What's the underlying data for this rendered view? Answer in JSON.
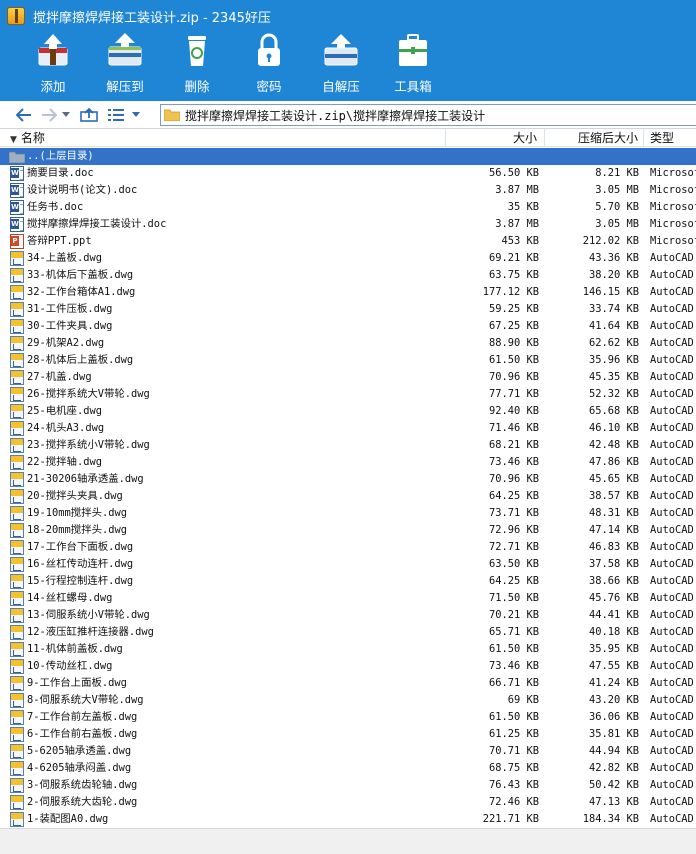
{
  "window": {
    "title": "搅拌摩擦焊焊接工装设计.zip - 2345好压"
  },
  "toolbar": {
    "items": [
      {
        "label": "添加",
        "icon": "add-archive-icon"
      },
      {
        "label": "解压到",
        "icon": "extract-to-icon"
      },
      {
        "label": "删除",
        "icon": "delete-trash-icon"
      },
      {
        "label": "密码",
        "icon": "password-lock-icon"
      },
      {
        "label": "自解压",
        "icon": "self-extract-icon"
      },
      {
        "label": "工具箱",
        "icon": "toolbox-icon"
      }
    ]
  },
  "address": {
    "path": "搅拌摩擦焊焊接工装设计.zip\\搅拌摩擦焊焊接工装设计"
  },
  "columns": {
    "name": "名称",
    "size": "大小",
    "csize": "压缩后大小",
    "type": "类型"
  },
  "files": [
    {
      "name": "..(上层目录)",
      "size": "",
      "csize": "",
      "type": "",
      "icon": "folder",
      "selected": true
    },
    {
      "name": "摘要目录.doc",
      "size": "56.50 KB",
      "csize": "8.21 KB",
      "type": "Microsoft",
      "icon": "doc"
    },
    {
      "name": "设计说明书(论文).doc",
      "size": "3.87 MB",
      "csize": "3.05 MB",
      "type": "Microsoft",
      "icon": "doc"
    },
    {
      "name": "任务书.doc",
      "size": "35 KB",
      "csize": "5.70 KB",
      "type": "Microsoft",
      "icon": "doc"
    },
    {
      "name": "搅拌摩擦焊焊接工装设计.doc",
      "size": "3.87 MB",
      "csize": "3.05 MB",
      "type": "Microsoft",
      "icon": "doc"
    },
    {
      "name": "答辩PPT.ppt",
      "size": "453 KB",
      "csize": "212.02 KB",
      "type": "Microsoft",
      "icon": "ppt"
    },
    {
      "name": "34-上盖板.dwg",
      "size": "69.21 KB",
      "csize": "43.36 KB",
      "type": "AutoCAD",
      "icon": "dwg"
    },
    {
      "name": "33-机体后下盖板.dwg",
      "size": "63.75 KB",
      "csize": "38.20 KB",
      "type": "AutoCAD",
      "icon": "dwg"
    },
    {
      "name": "32-工作台箱体A1.dwg",
      "size": "177.12 KB",
      "csize": "146.15 KB",
      "type": "AutoCAD",
      "icon": "dwg"
    },
    {
      "name": "31-工件压板.dwg",
      "size": "59.25 KB",
      "csize": "33.74 KB",
      "type": "AutoCAD",
      "icon": "dwg"
    },
    {
      "name": "30-工件夹具.dwg",
      "size": "67.25 KB",
      "csize": "41.64 KB",
      "type": "AutoCAD",
      "icon": "dwg"
    },
    {
      "name": "29-机架A2.dwg",
      "size": "88.90 KB",
      "csize": "62.62 KB",
      "type": "AutoCAD",
      "icon": "dwg"
    },
    {
      "name": "28-机体后上盖板.dwg",
      "size": "61.50 KB",
      "csize": "35.96 KB",
      "type": "AutoCAD",
      "icon": "dwg"
    },
    {
      "name": "27-机盖.dwg",
      "size": "70.96 KB",
      "csize": "45.35 KB",
      "type": "AutoCAD",
      "icon": "dwg"
    },
    {
      "name": "26-搅拌系统大V带轮.dwg",
      "size": "77.71 KB",
      "csize": "52.32 KB",
      "type": "AutoCAD",
      "icon": "dwg"
    },
    {
      "name": "25-电机座.dwg",
      "size": "92.40 KB",
      "csize": "65.68 KB",
      "type": "AutoCAD",
      "icon": "dwg"
    },
    {
      "name": "24-机头A3.dwg",
      "size": "71.46 KB",
      "csize": "46.10 KB",
      "type": "AutoCAD",
      "icon": "dwg"
    },
    {
      "name": "23-搅拌系统小V带轮.dwg",
      "size": "68.21 KB",
      "csize": "42.48 KB",
      "type": "AutoCAD",
      "icon": "dwg"
    },
    {
      "name": "22-搅拌轴.dwg",
      "size": "73.46 KB",
      "csize": "47.86 KB",
      "type": "AutoCAD",
      "icon": "dwg"
    },
    {
      "name": "21-30206轴承透盖.dwg",
      "size": "70.96 KB",
      "csize": "45.65 KB",
      "type": "AutoCAD",
      "icon": "dwg"
    },
    {
      "name": "20-搅拌头夹具.dwg",
      "size": "64.25 KB",
      "csize": "38.57 KB",
      "type": "AutoCAD",
      "icon": "dwg"
    },
    {
      "name": "19-10mm搅拌头.dwg",
      "size": "73.71 KB",
      "csize": "48.31 KB",
      "type": "AutoCAD",
      "icon": "dwg"
    },
    {
      "name": "18-20mm搅拌头.dwg",
      "size": "72.96 KB",
      "csize": "47.14 KB",
      "type": "AutoCAD",
      "icon": "dwg"
    },
    {
      "name": "17-工作台下面板.dwg",
      "size": "72.71 KB",
      "csize": "46.83 KB",
      "type": "AutoCAD",
      "icon": "dwg"
    },
    {
      "name": "16-丝杠传动连杆.dwg",
      "size": "63.50 KB",
      "csize": "37.58 KB",
      "type": "AutoCAD",
      "icon": "dwg"
    },
    {
      "name": "15-行程控制连杆.dwg",
      "size": "64.25 KB",
      "csize": "38.66 KB",
      "type": "AutoCAD",
      "icon": "dwg"
    },
    {
      "name": "14-丝杠螺母.dwg",
      "size": "71.50 KB",
      "csize": "45.76 KB",
      "type": "AutoCAD",
      "icon": "dwg"
    },
    {
      "name": "13-伺服系统小V带轮.dwg",
      "size": "70.21 KB",
      "csize": "44.41 KB",
      "type": "AutoCAD",
      "icon": "dwg"
    },
    {
      "name": "12-液压缸推杆连接器.dwg",
      "size": "65.71 KB",
      "csize": "40.18 KB",
      "type": "AutoCAD",
      "icon": "dwg"
    },
    {
      "name": "11-机体前盖板.dwg",
      "size": "61.50 KB",
      "csize": "35.95 KB",
      "type": "AutoCAD",
      "icon": "dwg"
    },
    {
      "name": "10-传动丝杠.dwg",
      "size": "73.46 KB",
      "csize": "47.55 KB",
      "type": "AutoCAD",
      "icon": "dwg"
    },
    {
      "name": "9-工作台上面板.dwg",
      "size": "66.71 KB",
      "csize": "41.24 KB",
      "type": "AutoCAD",
      "icon": "dwg"
    },
    {
      "name": "8-伺服系统大V带轮.dwg",
      "size": "69 KB",
      "csize": "43.20 KB",
      "type": "AutoCAD",
      "icon": "dwg"
    },
    {
      "name": "7-工作台前左盖板.dwg",
      "size": "61.50 KB",
      "csize": "36.06 KB",
      "type": "AutoCAD",
      "icon": "dwg"
    },
    {
      "name": "6-工作台前右盖板.dwg",
      "size": "61.25 KB",
      "csize": "35.81 KB",
      "type": "AutoCAD",
      "icon": "dwg"
    },
    {
      "name": "5-6205轴承透盖.dwg",
      "size": "70.71 KB",
      "csize": "44.94 KB",
      "type": "AutoCAD",
      "icon": "dwg"
    },
    {
      "name": "4-6205轴承闷盖.dwg",
      "size": "68.75 KB",
      "csize": "42.82 KB",
      "type": "AutoCAD",
      "icon": "dwg"
    },
    {
      "name": "3-伺服系统齿轮轴.dwg",
      "size": "76.43 KB",
      "csize": "50.42 KB",
      "type": "AutoCAD",
      "icon": "dwg"
    },
    {
      "name": "2-伺服系统大齿轮.dwg",
      "size": "72.46 KB",
      "csize": "47.13 KB",
      "type": "AutoCAD",
      "icon": "dwg"
    },
    {
      "name": "1-装配图A0.dwg",
      "size": "221.71 KB",
      "csize": "184.34 KB",
      "type": "AutoCAD",
      "icon": "dwg"
    }
  ],
  "status": {
    "text": ""
  },
  "colors": {
    "header_bg": "#1f86d6",
    "selected_row": "#3272c8"
  }
}
